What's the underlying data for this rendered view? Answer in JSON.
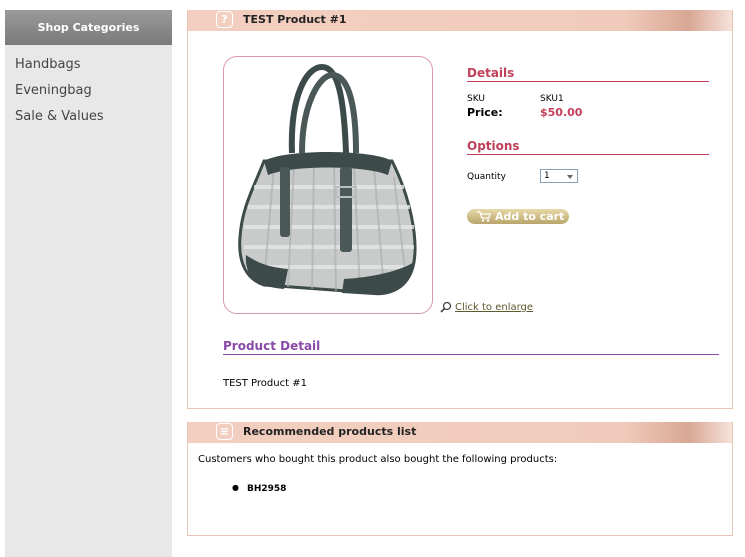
{
  "sidebar": {
    "header": "Shop Categories",
    "items": [
      {
        "label": "Handbags"
      },
      {
        "label": "Eveningbag"
      },
      {
        "label": "Sale & Values"
      }
    ]
  },
  "product_panel": {
    "title": "TEST Product #1",
    "header_icon": "question-icon",
    "image": {
      "alt": "handbag-photo"
    },
    "enlarge_label": "Click to enlarge",
    "details": {
      "title": "Details",
      "sku_label": "SKU",
      "sku_value": "SKU1",
      "price_label": "Price:",
      "price_value": "$50.00"
    },
    "options": {
      "title": "Options",
      "quantity_label": "Quantity",
      "quantity_value": "1"
    },
    "add_to_cart_label": "Add to cart",
    "product_detail_title": "Product Detail",
    "product_detail_text": "TEST Product #1"
  },
  "recommended_panel": {
    "title": "Recommended products list",
    "header_icon": "list-icon",
    "intro": "Customers who bought this product also bought the following products:",
    "items": [
      {
        "label": "BH2958"
      }
    ]
  },
  "colors": {
    "accent_red": "#c0405a",
    "accent_purple": "#8a4aa8",
    "header_bg": "#f0cbbb",
    "sidebar_bg": "#e8e8e8"
  }
}
